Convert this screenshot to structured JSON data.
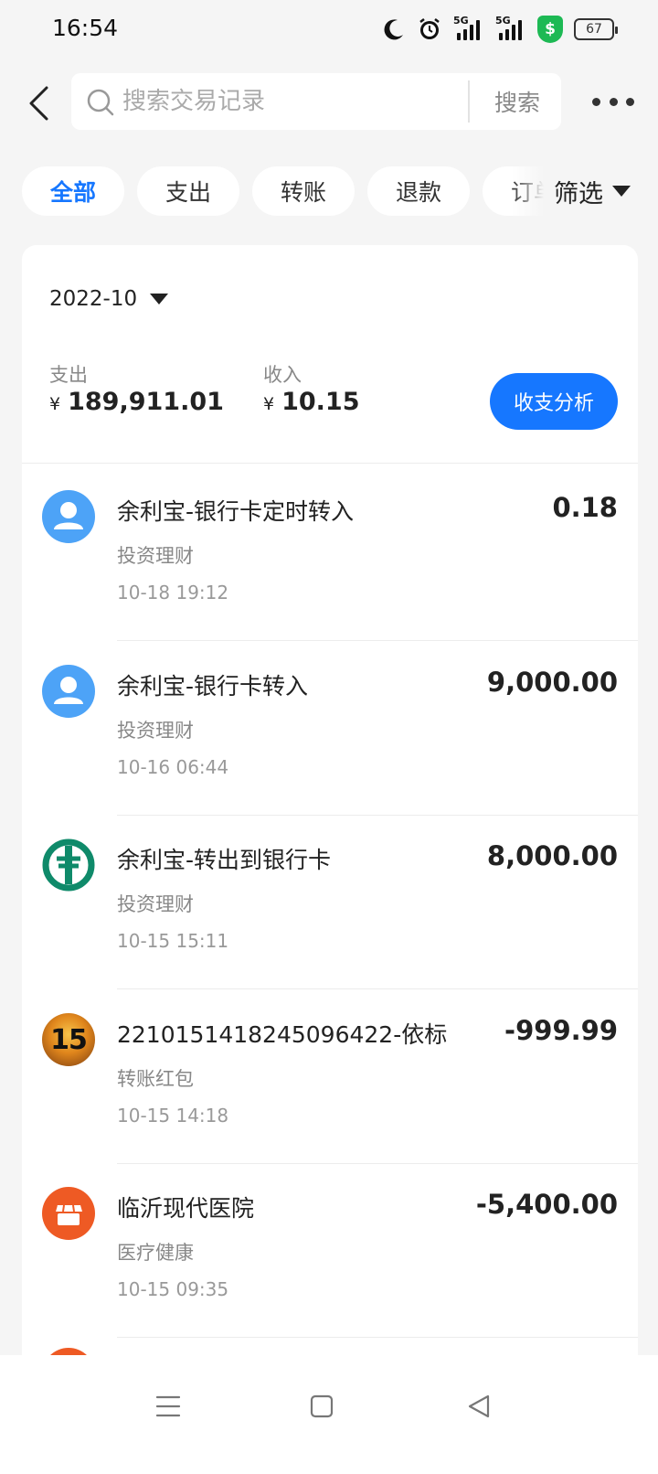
{
  "status_bar": {
    "time": "16:54",
    "signal_tag": "5G",
    "battery": "67"
  },
  "search": {
    "placeholder": "搜索交易记录",
    "button_label": "搜索"
  },
  "filters": {
    "chips": [
      "全部",
      "支出",
      "转账",
      "退款",
      "订单"
    ],
    "active_index": 0,
    "filter_label": "筛选"
  },
  "summary": {
    "month": "2022-10",
    "expense_label": "支出",
    "expense_currency": "¥",
    "expense_amount": "189,911.01",
    "income_label": "收入",
    "income_currency": "¥",
    "income_amount": "10.15",
    "analysis_button": "收支分析"
  },
  "transactions": [
    {
      "title": "余利宝-银行卡定时转入",
      "category": "投资理财",
      "time": "10-18 19:12",
      "amount": "0.18",
      "avatar": "person-avatar-icon"
    },
    {
      "title": "余利宝-银行卡转入",
      "category": "投资理财",
      "time": "10-16 06:44",
      "amount": "9,000.00",
      "avatar": "person-avatar-icon"
    },
    {
      "title": "余利宝-转出到银行卡",
      "category": "投资理财",
      "time": "10-15 15:11",
      "amount": "8,000.00",
      "avatar": "bank-logo-icon"
    },
    {
      "title": "2210151418245096422-依标",
      "category": "转账红包",
      "time": "10-15 14:18",
      "amount": "-999.99",
      "avatar": "photo-avatar",
      "avatar_text": "15"
    },
    {
      "title": "临沂现代医院",
      "category": "医疗健康",
      "time": "10-15 09:35",
      "amount": "-5,400.00",
      "avatar": "store-icon"
    }
  ],
  "colors": {
    "accent": "#1677ff",
    "avatar_blue": "#4da3f7",
    "bank_green": "#0f8a6a",
    "merchant_orange": "#ee5a24"
  }
}
